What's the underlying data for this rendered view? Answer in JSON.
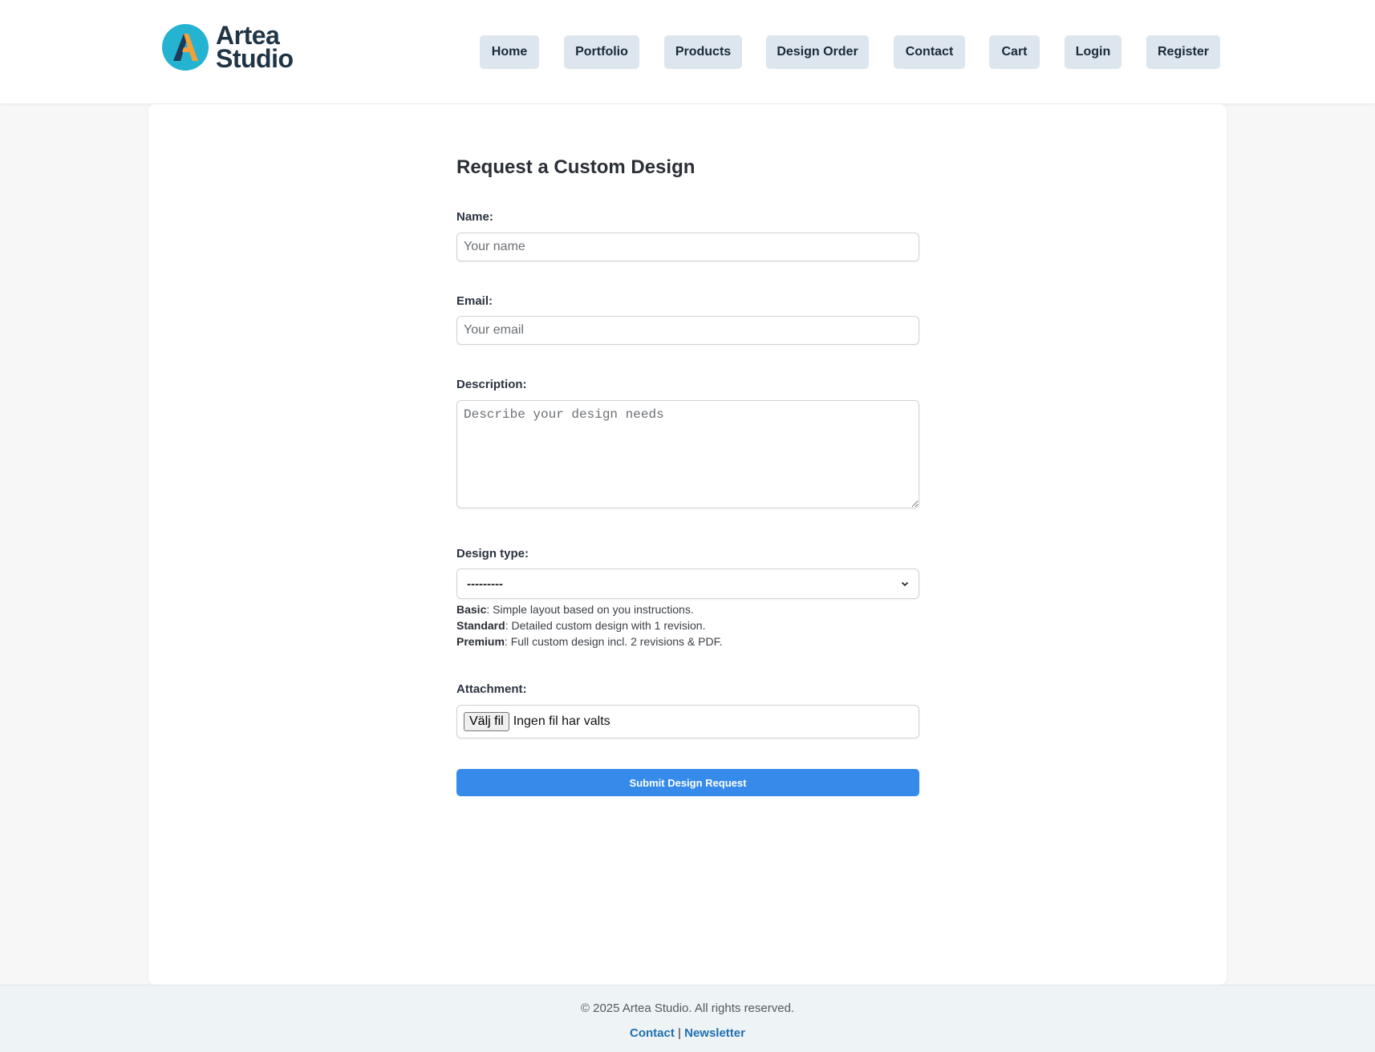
{
  "brand": {
    "name_line1": "Artea",
    "name_line2": "Studio",
    "colors": {
      "circle": "#24b3d1",
      "mark_dark": "#1d3b59",
      "mark_orange": "#f0a13a",
      "text": "#1f3445"
    }
  },
  "nav": {
    "items": [
      {
        "label": "Home"
      },
      {
        "label": "Portfolio"
      },
      {
        "label": "Products"
      },
      {
        "label": "Design Order"
      },
      {
        "label": "Contact"
      },
      {
        "label": "Cart"
      },
      {
        "label": "Login"
      },
      {
        "label": "Register"
      }
    ]
  },
  "form": {
    "title": "Request a Custom Design",
    "name": {
      "label": "Name:",
      "placeholder": "Your name"
    },
    "email": {
      "label": "Email:",
      "placeholder": "Your email"
    },
    "description": {
      "label": "Description:",
      "placeholder": "Describe your design needs"
    },
    "design_type": {
      "label": "Design type:",
      "selected": "---------",
      "help": [
        {
          "name": "Basic",
          "text": ": Simple layout based on you instructions."
        },
        {
          "name": "Standard",
          "text": ": Detailed custom design with 1 revision."
        },
        {
          "name": "Premium",
          "text": ": Full custom design incl. 2 revisions & PDF."
        }
      ]
    },
    "attachment": {
      "label": "Attachment:",
      "button": "Välj fil",
      "status": "Ingen fil har valts"
    },
    "submit_label": "Submit Design Request"
  },
  "footer": {
    "copyright": "© 2025 Artea Studio. All rights reserved.",
    "link_contact": "Contact",
    "separator": "|",
    "link_newsletter": "Newsletter"
  },
  "colors": {
    "accent": "#368bea",
    "nav_bg": "#dde6ee",
    "link": "#1f6fb0"
  }
}
